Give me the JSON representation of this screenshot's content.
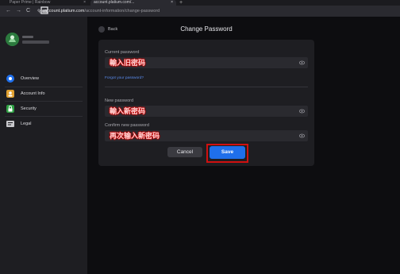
{
  "browser": {
    "tabs": [
      {
        "label": "Paper Prime | Rainbow",
        "active": false
      },
      {
        "label": "account.platium.com/...",
        "active": true
      }
    ],
    "new_tab_label": "+",
    "tab_close": "×",
    "nav_back": "←",
    "nav_forward": "→",
    "nav_reload": "C",
    "url_host": "account.platium.com",
    "url_path": "/account-information/change-password"
  },
  "sidebar": {
    "items": [
      {
        "label": "Overview",
        "icon": "overview-icon",
        "color": "#1f6feb"
      },
      {
        "label": "Account Info",
        "icon": "account-info-icon",
        "color": "#e0a030"
      },
      {
        "label": "Security",
        "icon": "security-lock-icon",
        "color": "#2ea043"
      },
      {
        "label": "Legal",
        "icon": "legal-doc-icon",
        "color": "#c8c8cc"
      }
    ]
  },
  "header": {
    "back_label": "Back",
    "title": "Change Password"
  },
  "form": {
    "current_label": "Current password",
    "current_placeholder": "輸入旧密码",
    "forgot_label": "Forgot your password?",
    "new_label": "New password",
    "new_placeholder": "輸入新密码",
    "confirm_label": "Confirm new password",
    "confirm_placeholder": "再次输入新密码",
    "cancel_label": "Cancel",
    "save_label": "Save"
  },
  "colors": {
    "accent": "#1f6feb",
    "highlight": "#d01010",
    "background": "#0d0d10",
    "panel": "#1e1e22"
  }
}
